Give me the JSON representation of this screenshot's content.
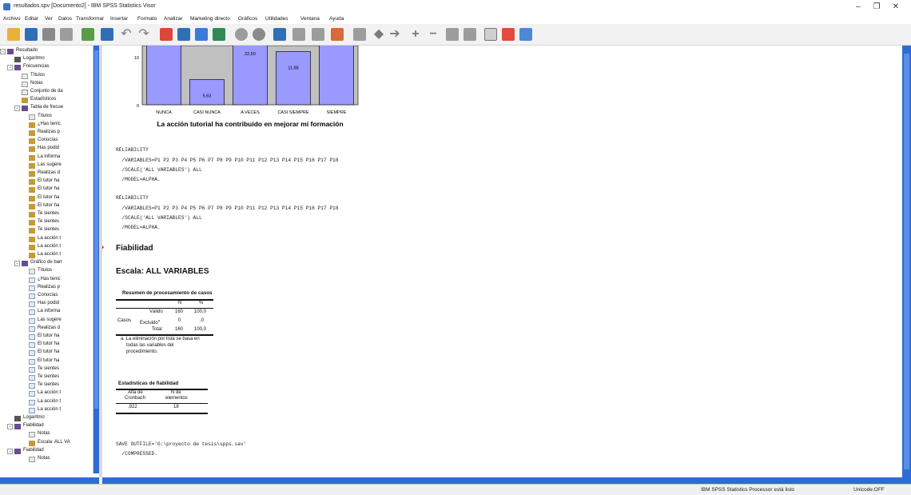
{
  "window": {
    "title": "resultados.spv [Documento2] - IBM SPSS Statistics Visor",
    "minimize": "–",
    "maximize": "❐",
    "close": "✕"
  },
  "menu": [
    "Archivo",
    "Editar",
    "Ver",
    "Datos",
    "Transformar",
    "Insertar",
    "Formato",
    "Analizar",
    "Marketing directo",
    "Gráficos",
    "Utilidades",
    "Ventana",
    "Ayuda"
  ],
  "tree": [
    {
      "label": "Resultado",
      "icon": "book"
    },
    {
      "label": "Logaritmo",
      "icon": "log"
    },
    {
      "label": "Frecuencias",
      "icon": "book"
    },
    {
      "label": "Títulos",
      "icon": "note"
    },
    {
      "label": "Notas",
      "icon": "note"
    },
    {
      "label": "Conjunto de da",
      "icon": "doc"
    },
    {
      "label": "Estadísticos",
      "icon": "table"
    },
    {
      "label": "Tabla de frecue",
      "icon": "book"
    },
    {
      "label": "Títulos",
      "icon": "note"
    },
    {
      "label": "¿Has tenic",
      "icon": "table"
    },
    {
      "label": "Realizas p",
      "icon": "table"
    },
    {
      "label": "Conocías",
      "icon": "table"
    },
    {
      "label": "Has podid",
      "icon": "table"
    },
    {
      "label": "La informa",
      "icon": "table"
    },
    {
      "label": "Las sugere",
      "icon": "table"
    },
    {
      "label": "Realizas d",
      "icon": "table"
    },
    {
      "label": "El tutor ha",
      "icon": "table"
    },
    {
      "label": "El tutor ha",
      "icon": "table"
    },
    {
      "label": "El tutor ha",
      "icon": "table"
    },
    {
      "label": "El tutor ha",
      "icon": "table"
    },
    {
      "label": "Te sientes",
      "icon": "table"
    },
    {
      "label": "Te sientes",
      "icon": "table"
    },
    {
      "label": "Te sientes",
      "icon": "table"
    },
    {
      "label": "La acción t",
      "icon": "table"
    },
    {
      "label": "La acción t",
      "icon": "table"
    },
    {
      "label": "La acción t",
      "icon": "table"
    },
    {
      "label": "Gráfico de barr",
      "icon": "book"
    },
    {
      "label": "Títulos",
      "icon": "note"
    },
    {
      "label": "¿Has tenic",
      "icon": "chart"
    },
    {
      "label": "Realizas p",
      "icon": "chart"
    },
    {
      "label": "Conocías",
      "icon": "chart"
    },
    {
      "label": "Has podid",
      "icon": "chart"
    },
    {
      "label": "La informa",
      "icon": "chart"
    },
    {
      "label": "Las sugere",
      "icon": "chart"
    },
    {
      "label": "Realizas d",
      "icon": "chart"
    },
    {
      "label": "El tutor ha",
      "icon": "chart"
    },
    {
      "label": "El tutor ha",
      "icon": "chart"
    },
    {
      "label": "El tutor ha",
      "icon": "chart"
    },
    {
      "label": "El tutor ha",
      "icon": "chart"
    },
    {
      "label": "Te sientes",
      "icon": "chart"
    },
    {
      "label": "Te sientes",
      "icon": "chart"
    },
    {
      "label": "Te sientes",
      "icon": "chart"
    },
    {
      "label": "La acción t",
      "icon": "chart"
    },
    {
      "label": "La acción t",
      "icon": "chart"
    },
    {
      "label": "La acción t",
      "icon": "chart"
    },
    {
      "label": "Logaritmo",
      "icon": "log"
    },
    {
      "label": "Fiabilidad",
      "icon": "book"
    },
    {
      "label": "Notas",
      "icon": "note"
    },
    {
      "label": "Escala: ALL VA",
      "icon": "table"
    },
    {
      "label": "Fiabilidad",
      "icon": "book"
    },
    {
      "label": "Notas",
      "icon": "note"
    }
  ],
  "chart_data": {
    "type": "bar",
    "categories": [
      "NUNCA",
      "CASI NUNCA",
      "A VECES",
      "CASI SIEMPRE",
      "SIEMPRE"
    ],
    "values": [
      null,
      5.63,
      22.5,
      11.88,
      null
    ],
    "value_labels": [
      "",
      "5,63",
      "22,50",
      "11,88",
      ""
    ],
    "ytick_labels": [
      "10",
      "0"
    ],
    "xlabel": "La acción tutorial ha contribuido en mejorar mi formación",
    "bar_color": "#9999ff",
    "background_color": "#c0c0c0"
  },
  "syntax1": [
    "RELIABILITY",
    "  /VARIABLES=P1 P2 P3 P4 P5 P6 P7 P8 P9 P10 P11 P12 P13 P14 P15 P16 P17 P18",
    "  /SCALE('ALL VARIABLES') ALL",
    "  /MODEL=ALPHA."
  ],
  "syntax2": [
    "RELIABILITY",
    "  /VARIABLES=P1 P2 P3 P4 P5 P6 P7 P8 P9 P10 P11 P12 P13 P14 P15 P16 P17 P18",
    "  /SCALE('ALL VARIABLES') ALL",
    "  /MODEL=ALPHA."
  ],
  "fiabilidad_title": "Fiabilidad",
  "escala_title": "Escala: ALL VARIABLES",
  "case_table": {
    "caption": "Resumen de procesamiento de casos",
    "col_n": "N",
    "col_pct": "%",
    "group": "Casos",
    "rows": [
      {
        "label": "Válido",
        "n": "160",
        "pct": "100,0"
      },
      {
        "label": "Excluido",
        "sup": "a",
        "n": "0",
        "pct": ",0"
      },
      {
        "label": "Total",
        "n": "160",
        "pct": "100,0"
      }
    ],
    "footnote": [
      "a. La eliminación por lista se basa en",
      "todas las variables del",
      "procedimiento."
    ]
  },
  "reliability_table": {
    "caption": "Estadísticas de fiabilidad",
    "col1": [
      "Alfa de",
      "Cronbach"
    ],
    "col2": [
      "N de",
      "elementos"
    ],
    "val1": ",922",
    "val2": "18"
  },
  "save_syntax": [
    "SAVE OUTFILE='G:\\proyecto de tesis\\spps.sav'",
    "  /COMPRESSED."
  ],
  "status": {
    "processor": "IBM SPSS Statistics Processor está listo",
    "unicode": "Unicode:OFF"
  }
}
